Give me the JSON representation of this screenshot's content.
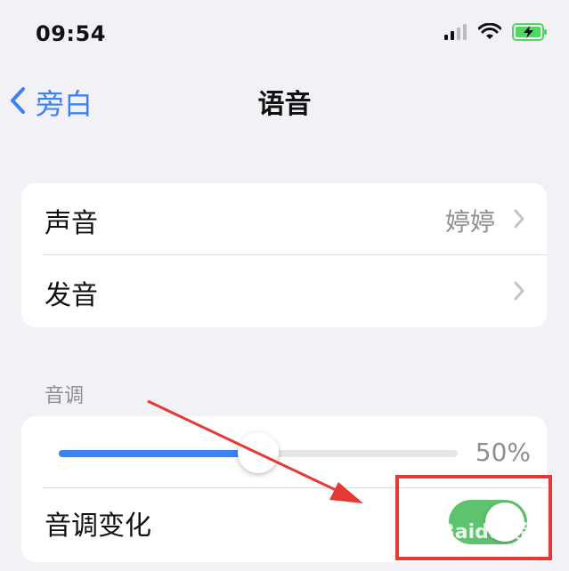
{
  "status_bar": {
    "time": "09:54",
    "icons": [
      "signal-icon",
      "wifi-icon",
      "battery-charging-icon"
    ],
    "battery_color": "#4cd964"
  },
  "nav": {
    "back_label": "旁白",
    "title": "语音"
  },
  "settings_group": {
    "rows": [
      {
        "label": "声音",
        "value": "婷婷"
      },
      {
        "label": "发音",
        "value": ""
      }
    ]
  },
  "pitch_section": {
    "header": "音调",
    "slider_value_text": "50%",
    "slider_fraction": 0.5,
    "toggle_label": "音调变化",
    "toggle_on": true
  },
  "annotation": {
    "color": "#e53935",
    "watermark": "Baidu 经验"
  },
  "colors": {
    "accent": "#3b82f6",
    "toggle_on": "#5ec36f",
    "background": "#f2f2f6"
  }
}
